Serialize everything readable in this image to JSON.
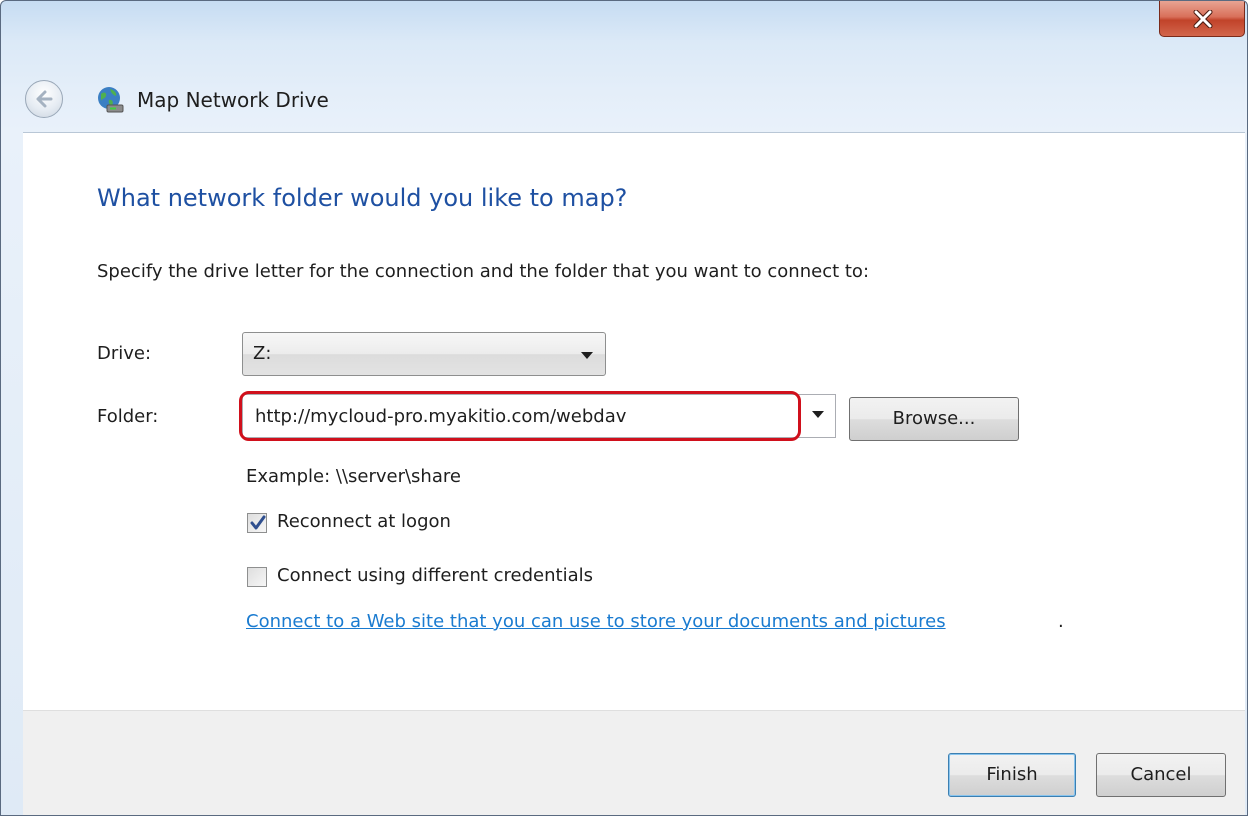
{
  "window": {
    "title": "Map Network Drive"
  },
  "page": {
    "heading": "What network folder would you like to map?",
    "instruction": "Specify the drive letter for the connection and the folder that you want to connect to:"
  },
  "form": {
    "drive_label": "Drive:",
    "drive_value": "Z:",
    "folder_label": "Folder:",
    "folder_value": "http://mycloud-pro.myakitio.com/webdav",
    "browse_label": "Browse...",
    "example_text": "Example: \\\\server\\share",
    "reconnect_label": "Reconnect at logon",
    "reconnect_checked": true,
    "credentials_label": "Connect using different credentials",
    "credentials_checked": false,
    "web_link_text": "Connect to a Web site that you can use to store your documents and pictures",
    "web_link_suffix": "."
  },
  "footer": {
    "finish_label": "Finish",
    "cancel_label": "Cancel"
  },
  "colors": {
    "heading": "#1e50a2",
    "link": "#1a7bd0",
    "highlight": "#d0101c",
    "close_button": "#c1432a"
  },
  "icons": {
    "close": "close-icon",
    "back": "back-arrow-icon",
    "title": "network-drive-icon",
    "checkmark": "checkmark-icon",
    "dropdown": "chevron-down-icon"
  }
}
